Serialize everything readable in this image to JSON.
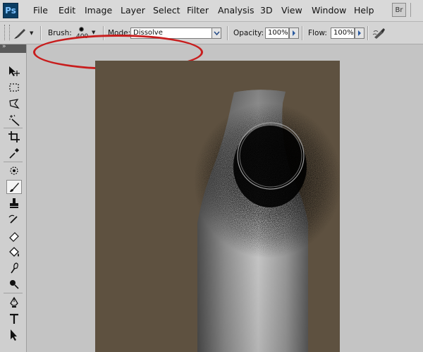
{
  "app": {
    "logo_text": "Ps",
    "bridge_label": "Br"
  },
  "menu": [
    "File",
    "Edit",
    "Image",
    "Layer",
    "Select",
    "Filter",
    "Analysis",
    "3D",
    "View",
    "Window",
    "Help"
  ],
  "options": {
    "brush_label": "Brush:",
    "brush_size": "400",
    "mode_label": "Mode:",
    "mode_value": "Dissolve",
    "opacity_label": "Opacity:",
    "opacity_value": "100%",
    "flow_label": "Flow:",
    "flow_value": "100%"
  },
  "tools": [
    {
      "name": "move-tool-icon"
    },
    {
      "name": "marquee-tool-icon"
    },
    {
      "name": "lasso-tool-icon"
    },
    {
      "name": "magic-wand-tool-icon"
    },
    {
      "name": "crop-tool-icon"
    },
    {
      "name": "eyedropper-tool-icon"
    },
    {
      "name": "spot-healing-tool-icon"
    },
    {
      "name": "brush-tool-icon",
      "active": true
    },
    {
      "name": "clone-stamp-tool-icon"
    },
    {
      "name": "history-brush-tool-icon"
    },
    {
      "name": "eraser-tool-icon"
    },
    {
      "name": "paint-bucket-tool-icon"
    },
    {
      "name": "smudge-tool-icon"
    },
    {
      "name": "dodge-tool-icon"
    },
    {
      "name": "pen-tool-icon"
    },
    {
      "name": "type-tool-icon"
    },
    {
      "name": "path-selection-tool-icon"
    }
  ],
  "colors": {
    "canvas_background": "#5e5140",
    "annotation": "#c81d1d",
    "workspace": "#c4c4c4"
  }
}
